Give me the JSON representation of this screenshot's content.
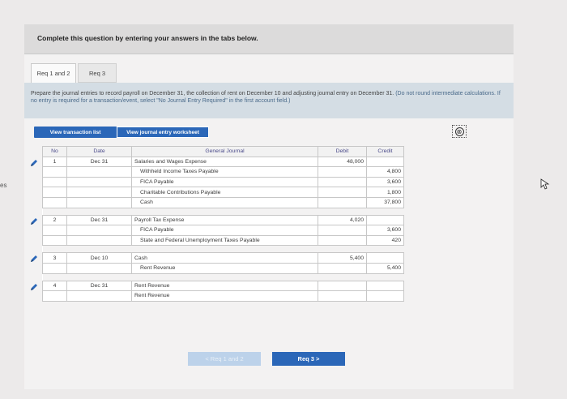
{
  "edge_text": "es",
  "question_header": "Complete this question by entering your answers in the tabs below.",
  "tabs": [
    {
      "label": "Req 1 and 2"
    },
    {
      "label": "Req 3"
    }
  ],
  "instructions": {
    "main": "Prepare the journal entries to record payroll on December 31, the collection of rent on December 10 and adjusting journal entry on December 31.",
    "note": "(Do not round intermediate calculations. If no entry is required for a transaction/event, select \"No Journal Entry Required\" in the first account field.)"
  },
  "buttons": {
    "view_list": "View transaction list",
    "view_worksheet": "View journal entry worksheet",
    "close_icon": "⊗"
  },
  "table": {
    "headers": {
      "no": "No",
      "date": "Date",
      "account": "General Journal",
      "debit": "Debit",
      "credit": "Credit"
    },
    "entries": [
      {
        "no": "1",
        "date": "Dec 31",
        "lines": [
          {
            "account": "Salaries and Wages Expense",
            "debit": "48,000",
            "credit": "",
            "indent": false
          },
          {
            "account": "Withheld Income Taxes Payable",
            "debit": "",
            "credit": "4,800",
            "indent": true
          },
          {
            "account": "FICA Payable",
            "debit": "",
            "credit": "3,600",
            "indent": true
          },
          {
            "account": "Charitable Contributions Payable",
            "debit": "",
            "credit": "1,800",
            "indent": true
          },
          {
            "account": "Cash",
            "debit": "",
            "credit": "37,800",
            "indent": true
          }
        ]
      },
      {
        "no": "2",
        "date": "Dec 31",
        "lines": [
          {
            "account": "Payroll Tax Expense",
            "debit": "4,020",
            "credit": "",
            "indent": false
          },
          {
            "account": "FICA Payable",
            "debit": "",
            "credit": "3,600",
            "indent": true
          },
          {
            "account": "State and Federal Unemployment Taxes Payable",
            "debit": "",
            "credit": "420",
            "indent": true
          }
        ]
      },
      {
        "no": "3",
        "date": "Dec 10",
        "lines": [
          {
            "account": "Cash",
            "debit": "5,400",
            "credit": "",
            "indent": false
          },
          {
            "account": "Rent Revenue",
            "debit": "",
            "credit": "5,400",
            "indent": true
          }
        ]
      },
      {
        "no": "4",
        "date": "Dec 31",
        "lines": [
          {
            "account": "Rent Revenue",
            "debit": "",
            "credit": "",
            "indent": false
          },
          {
            "account": "Rent Revenue",
            "debit": "",
            "credit": "",
            "indent": false
          }
        ]
      }
    ]
  },
  "navigation": {
    "prev_label": "< Req 1 and 2",
    "next_label": "Req 3 >"
  },
  "colors": {
    "accent": "#2b67b8",
    "instructions_bg": "#d4dde4",
    "header_bg": "#dcdbdb"
  }
}
